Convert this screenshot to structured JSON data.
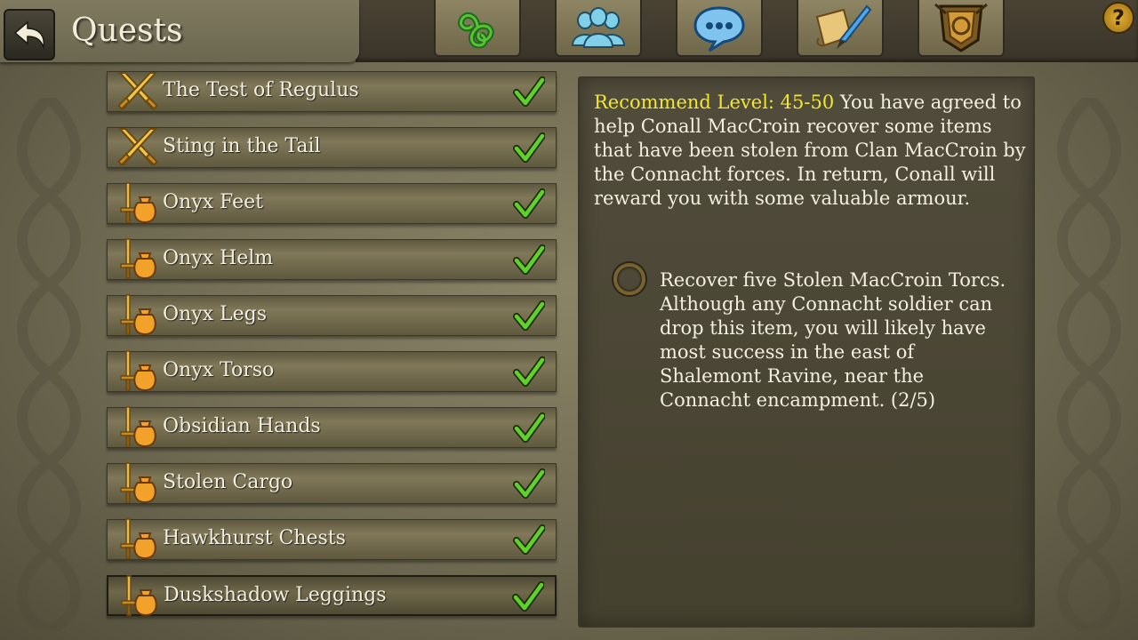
{
  "header": {
    "title": "Quests",
    "help_label": "?"
  },
  "tabs": [
    {
      "name": "triskele-icon"
    },
    {
      "name": "party-icon"
    },
    {
      "name": "chat-icon"
    },
    {
      "name": "quest-scroll-icon"
    },
    {
      "name": "guild-crest-icon"
    }
  ],
  "quests": [
    {
      "name": "The Test of Regulus",
      "icon": "crossed-swords-icon",
      "completed": true
    },
    {
      "name": "Sting in the Tail",
      "icon": "crossed-swords-icon",
      "completed": true
    },
    {
      "name": "Onyx Feet",
      "icon": "sword-and-bag-icon",
      "completed": true
    },
    {
      "name": "Onyx Helm",
      "icon": "sword-and-bag-icon",
      "completed": true
    },
    {
      "name": "Onyx Legs",
      "icon": "sword-and-bag-icon",
      "completed": true
    },
    {
      "name": "Onyx Torso",
      "icon": "sword-and-bag-icon",
      "completed": true
    },
    {
      "name": "Obsidian Hands",
      "icon": "sword-and-bag-icon",
      "completed": true
    },
    {
      "name": "Stolen Cargo",
      "icon": "sword-and-bag-icon",
      "completed": true
    },
    {
      "name": "Hawkhurst Chests",
      "icon": "sword-and-bag-icon",
      "completed": true
    },
    {
      "name": "Duskshadow Leggings",
      "icon": "sword-and-bag-icon",
      "completed": true,
      "selected": true
    }
  ],
  "details": {
    "level_label": "Recommend Level: 45-50",
    "description": "You have agreed to help Conall MacCroin recover some items that have been stolen from Clan MacCroin by the Connacht forces. In return, Conall will reward you with some valuable armour.",
    "objective": "Recover five Stolen MacCroin Torcs. Although any Connacht soldier can drop this item, you will likely have most success in the east of Shalemont Ravine, near the Connacht encampment. (2/5)",
    "objective_progress": 0.4
  },
  "colors": {
    "level_text": "#f3e631",
    "checkmark": "#5fd12a"
  }
}
